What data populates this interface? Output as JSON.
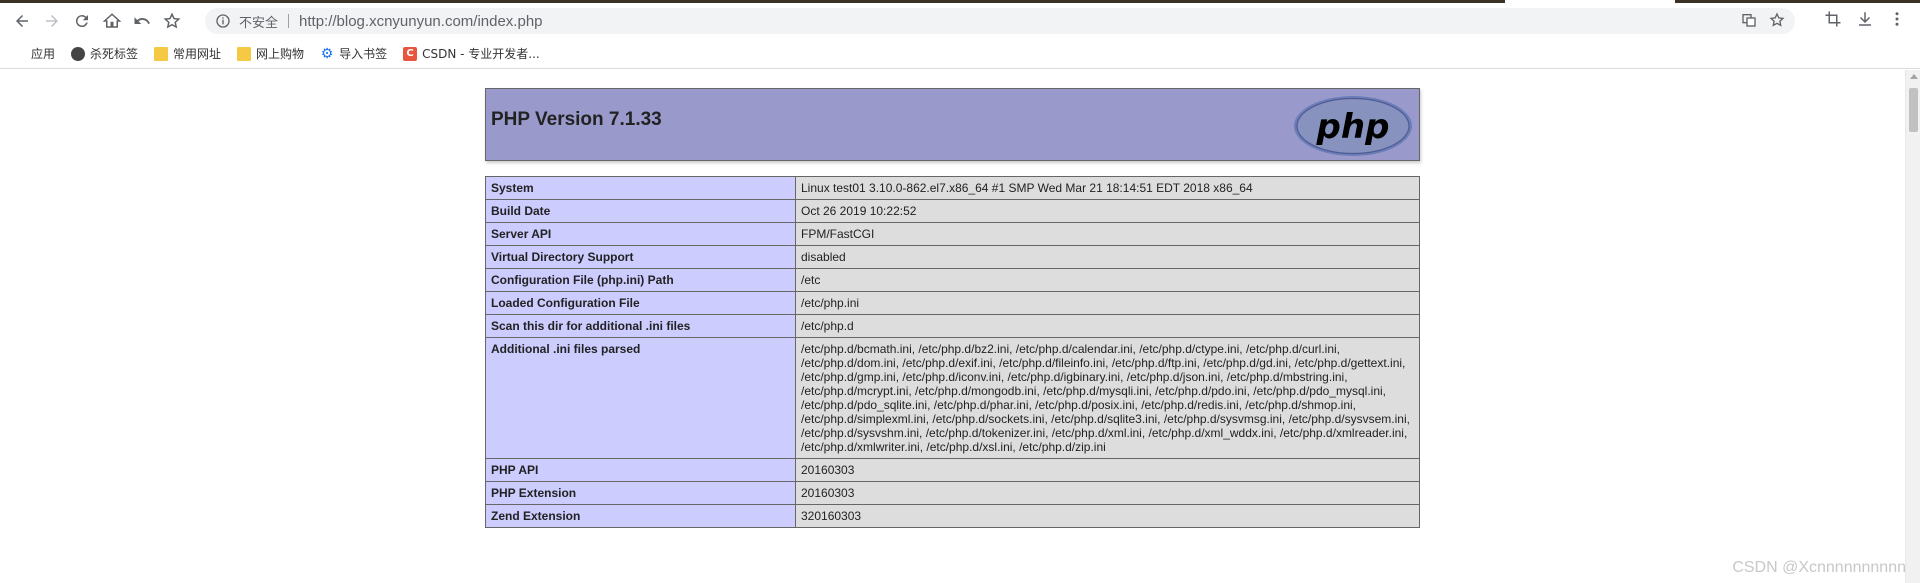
{
  "browser": {
    "omnibox": {
      "security_label": "不安全",
      "url": "http://blog.xcnyunyun.com/index.php"
    },
    "bookmarks": [
      {
        "label": "应用",
        "icon": "apps-grid-icon"
      },
      {
        "label": "杀死标签",
        "icon": "globe-icon"
      },
      {
        "label": "常用网址",
        "icon": "folder-icon"
      },
      {
        "label": "网上购物",
        "icon": "folder-icon"
      },
      {
        "label": "导入书签",
        "icon": "gear-icon"
      },
      {
        "label": "CSDN - 专业开发者...",
        "icon": "csdn-icon",
        "icon_text": "C"
      }
    ]
  },
  "phpinfo": {
    "title": "PHP Version 7.1.33",
    "logo_text": "php",
    "rows": [
      {
        "key": "System",
        "value": "Linux test01 3.10.0-862.el7.x86_64 #1 SMP Wed Mar 21 18:14:51 EDT 2018 x86_64"
      },
      {
        "key": "Build Date",
        "value": "Oct 26 2019 10:22:52"
      },
      {
        "key": "Server API",
        "value": "FPM/FastCGI"
      },
      {
        "key": "Virtual Directory Support",
        "value": "disabled"
      },
      {
        "key": "Configuration File (php.ini) Path",
        "value": "/etc"
      },
      {
        "key": "Loaded Configuration File",
        "value": "/etc/php.ini"
      },
      {
        "key": "Scan this dir for additional .ini files",
        "value": "/etc/php.d"
      },
      {
        "key": "Additional .ini files parsed",
        "value": "/etc/php.d/bcmath.ini, /etc/php.d/bz2.ini, /etc/php.d/calendar.ini, /etc/php.d/ctype.ini, /etc/php.d/curl.ini, /etc/php.d/dom.ini, /etc/php.d/exif.ini, /etc/php.d/fileinfo.ini, /etc/php.d/ftp.ini, /etc/php.d/gd.ini, /etc/php.d/gettext.ini, /etc/php.d/gmp.ini, /etc/php.d/iconv.ini, /etc/php.d/igbinary.ini, /etc/php.d/json.ini, /etc/php.d/mbstring.ini, /etc/php.d/mcrypt.ini, /etc/php.d/mongodb.ini, /etc/php.d/mysqli.ini, /etc/php.d/pdo.ini, /etc/php.d/pdo_mysql.ini, /etc/php.d/pdo_sqlite.ini, /etc/php.d/phar.ini, /etc/php.d/posix.ini, /etc/php.d/redis.ini, /etc/php.d/shmop.ini, /etc/php.d/simplexml.ini, /etc/php.d/sockets.ini, /etc/php.d/sqlite3.ini, /etc/php.d/sysvmsg.ini, /etc/php.d/sysvsem.ini, /etc/php.d/sysvshm.ini, /etc/php.d/tokenizer.ini, /etc/php.d/xml.ini, /etc/php.d/xml_wddx.ini, /etc/php.d/xmlreader.ini, /etc/php.d/xmlwriter.ini, /etc/php.d/xsl.ini, /etc/php.d/zip.ini"
      },
      {
        "key": "PHP API",
        "value": "20160303"
      },
      {
        "key": "PHP Extension",
        "value": "20160303"
      },
      {
        "key": "Zend Extension",
        "value": "320160303"
      }
    ]
  },
  "watermark": "CSDN @Xcnnnnnnnnnn",
  "colors": {
    "header_bg": "#9999cc",
    "key_cell_bg": "#ccccff",
    "value_cell_bg": "#dddddd",
    "tabstrip": "#3a3226"
  }
}
